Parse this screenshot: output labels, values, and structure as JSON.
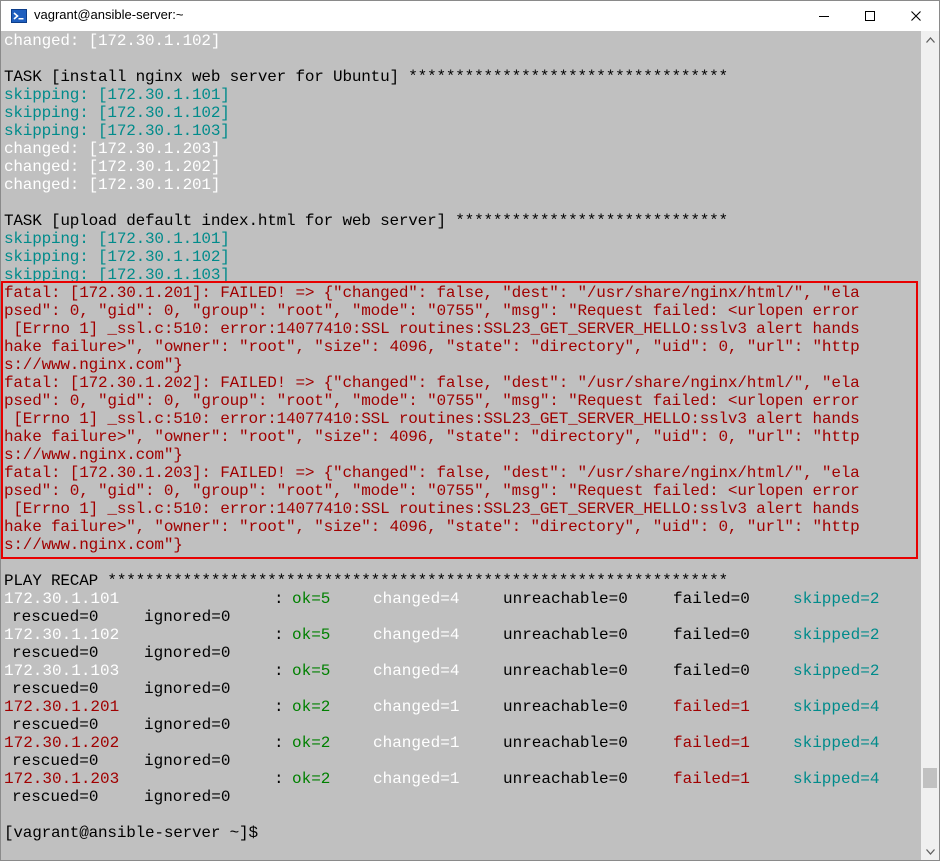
{
  "window": {
    "title": "vagrant@ansible-server:~",
    "minimize": "minimize",
    "maximize": "maximize",
    "close": "close"
  },
  "lines": [
    {
      "text": "changed: [172.30.1.102]",
      "color": "w"
    },
    {
      "text": "",
      "color": "k"
    },
    {
      "text": "TASK [install nginx web server for Ubuntu] **********************************",
      "color": "k"
    },
    {
      "text": "skipping: [172.30.1.101]",
      "color": "t"
    },
    {
      "text": "skipping: [172.30.1.102]",
      "color": "t"
    },
    {
      "text": "skipping: [172.30.1.103]",
      "color": "t"
    },
    {
      "text": "changed: [172.30.1.203]",
      "color": "w"
    },
    {
      "text": "changed: [172.30.1.202]",
      "color": "w"
    },
    {
      "text": "changed: [172.30.1.201]",
      "color": "w"
    },
    {
      "text": "",
      "color": "k"
    },
    {
      "text": "TASK [upload default index.html for web server] *****************************",
      "color": "k"
    },
    {
      "text": "skipping: [172.30.1.101]",
      "color": "t"
    },
    {
      "text": "skipping: [172.30.1.102]",
      "color": "t"
    },
    {
      "text": "skipping: [172.30.1.103]",
      "color": "t"
    },
    {
      "text": "fatal: [172.30.1.201]: FAILED! => {\"changed\": false, \"dest\": \"/usr/share/nginx/html/\", \"ela",
      "color": "r"
    },
    {
      "text": "psed\": 0, \"gid\": 0, \"group\": \"root\", \"mode\": \"0755\", \"msg\": \"Request failed: <urlopen error",
      "color": "r"
    },
    {
      "text": " [Errno 1] _ssl.c:510: error:14077410:SSL routines:SSL23_GET_SERVER_HELLO:sslv3 alert hands",
      "color": "r"
    },
    {
      "text": "hake failure>\", \"owner\": \"root\", \"size\": 4096, \"state\": \"directory\", \"uid\": 0, \"url\": \"http",
      "color": "r"
    },
    {
      "text": "s://www.nginx.com\"}",
      "color": "r"
    },
    {
      "text": "fatal: [172.30.1.202]: FAILED! => {\"changed\": false, \"dest\": \"/usr/share/nginx/html/\", \"ela",
      "color": "r"
    },
    {
      "text": "psed\": 0, \"gid\": 0, \"group\": \"root\", \"mode\": \"0755\", \"msg\": \"Request failed: <urlopen error",
      "color": "r"
    },
    {
      "text": " [Errno 1] _ssl.c:510: error:14077410:SSL routines:SSL23_GET_SERVER_HELLO:sslv3 alert hands",
      "color": "r"
    },
    {
      "text": "hake failure>\", \"owner\": \"root\", \"size\": 4096, \"state\": \"directory\", \"uid\": 0, \"url\": \"http",
      "color": "r"
    },
    {
      "text": "s://www.nginx.com\"}",
      "color": "r"
    },
    {
      "text": "fatal: [172.30.1.203]: FAILED! => {\"changed\": false, \"dest\": \"/usr/share/nginx/html/\", \"ela",
      "color": "r"
    },
    {
      "text": "psed\": 0, \"gid\": 0, \"group\": \"root\", \"mode\": \"0755\", \"msg\": \"Request failed: <urlopen error",
      "color": "r"
    },
    {
      "text": " [Errno 1] _ssl.c:510: error:14077410:SSL routines:SSL23_GET_SERVER_HELLO:sslv3 alert hands",
      "color": "r"
    },
    {
      "text": "hake failure>\", \"owner\": \"root\", \"size\": 4096, \"state\": \"directory\", \"uid\": 0, \"url\": \"http",
      "color": "r"
    },
    {
      "text": "s://www.nginx.com\"}",
      "color": "r"
    },
    {
      "text": "",
      "color": "k"
    },
    {
      "text": "PLAY RECAP ******************************************************************",
      "color": "k"
    }
  ],
  "recap": [
    {
      "host": "172.30.1.101",
      "host_color": "w",
      "sep": ":",
      "ok": "ok=5",
      "ok_color": "g",
      "changed": "changed=4",
      "unreachable": "unreachable=0",
      "failed": "failed=0",
      "failed_color": "k",
      "skipped": "skipped=2",
      "rescued": "rescued=0",
      "ignored": "ignored=0"
    },
    {
      "host": "172.30.1.102",
      "host_color": "w",
      "sep": ":",
      "ok": "ok=5",
      "ok_color": "g",
      "changed": "changed=4",
      "unreachable": "unreachable=0",
      "failed": "failed=0",
      "failed_color": "k",
      "skipped": "skipped=2",
      "rescued": "rescued=0",
      "ignored": "ignored=0"
    },
    {
      "host": "172.30.1.103",
      "host_color": "w",
      "sep": ":",
      "ok": "ok=5",
      "ok_color": "g",
      "changed": "changed=4",
      "unreachable": "unreachable=0",
      "failed": "failed=0",
      "failed_color": "k",
      "skipped": "skipped=2",
      "rescued": "rescued=0",
      "ignored": "ignored=0"
    },
    {
      "host": "172.30.1.201",
      "host_color": "r",
      "sep": ":",
      "ok": "ok=2",
      "ok_color": "g",
      "changed": "changed=1",
      "unreachable": "unreachable=0",
      "failed": "failed=1",
      "failed_color": "r",
      "skipped": "skipped=4",
      "rescued": "rescued=0",
      "ignored": "ignored=0"
    },
    {
      "host": "172.30.1.202",
      "host_color": "r",
      "sep": ":",
      "ok": "ok=2",
      "ok_color": "g",
      "changed": "changed=1",
      "unreachable": "unreachable=0",
      "failed": "failed=1",
      "failed_color": "r",
      "skipped": "skipped=4",
      "rescued": "rescued=0",
      "ignored": "ignored=0"
    },
    {
      "host": "172.30.1.203",
      "host_color": "r",
      "sep": ":",
      "ok": "ok=2",
      "ok_color": "g",
      "changed": "changed=1",
      "unreachable": "unreachable=0",
      "failed": "failed=1",
      "failed_color": "r",
      "skipped": "skipped=4",
      "rescued": "rescued=0",
      "ignored": "ignored=0"
    }
  ],
  "prompt": "[vagrant@ansible-server ~]$",
  "colors": {
    "terminal_bg": "#c0c0c0",
    "white": "#ffffff",
    "teal": "#008b8b",
    "red": "#a00000",
    "green": "#008000",
    "highlight_box": "#e80000"
  },
  "icons": {
    "app": "terminal-app-icon"
  }
}
